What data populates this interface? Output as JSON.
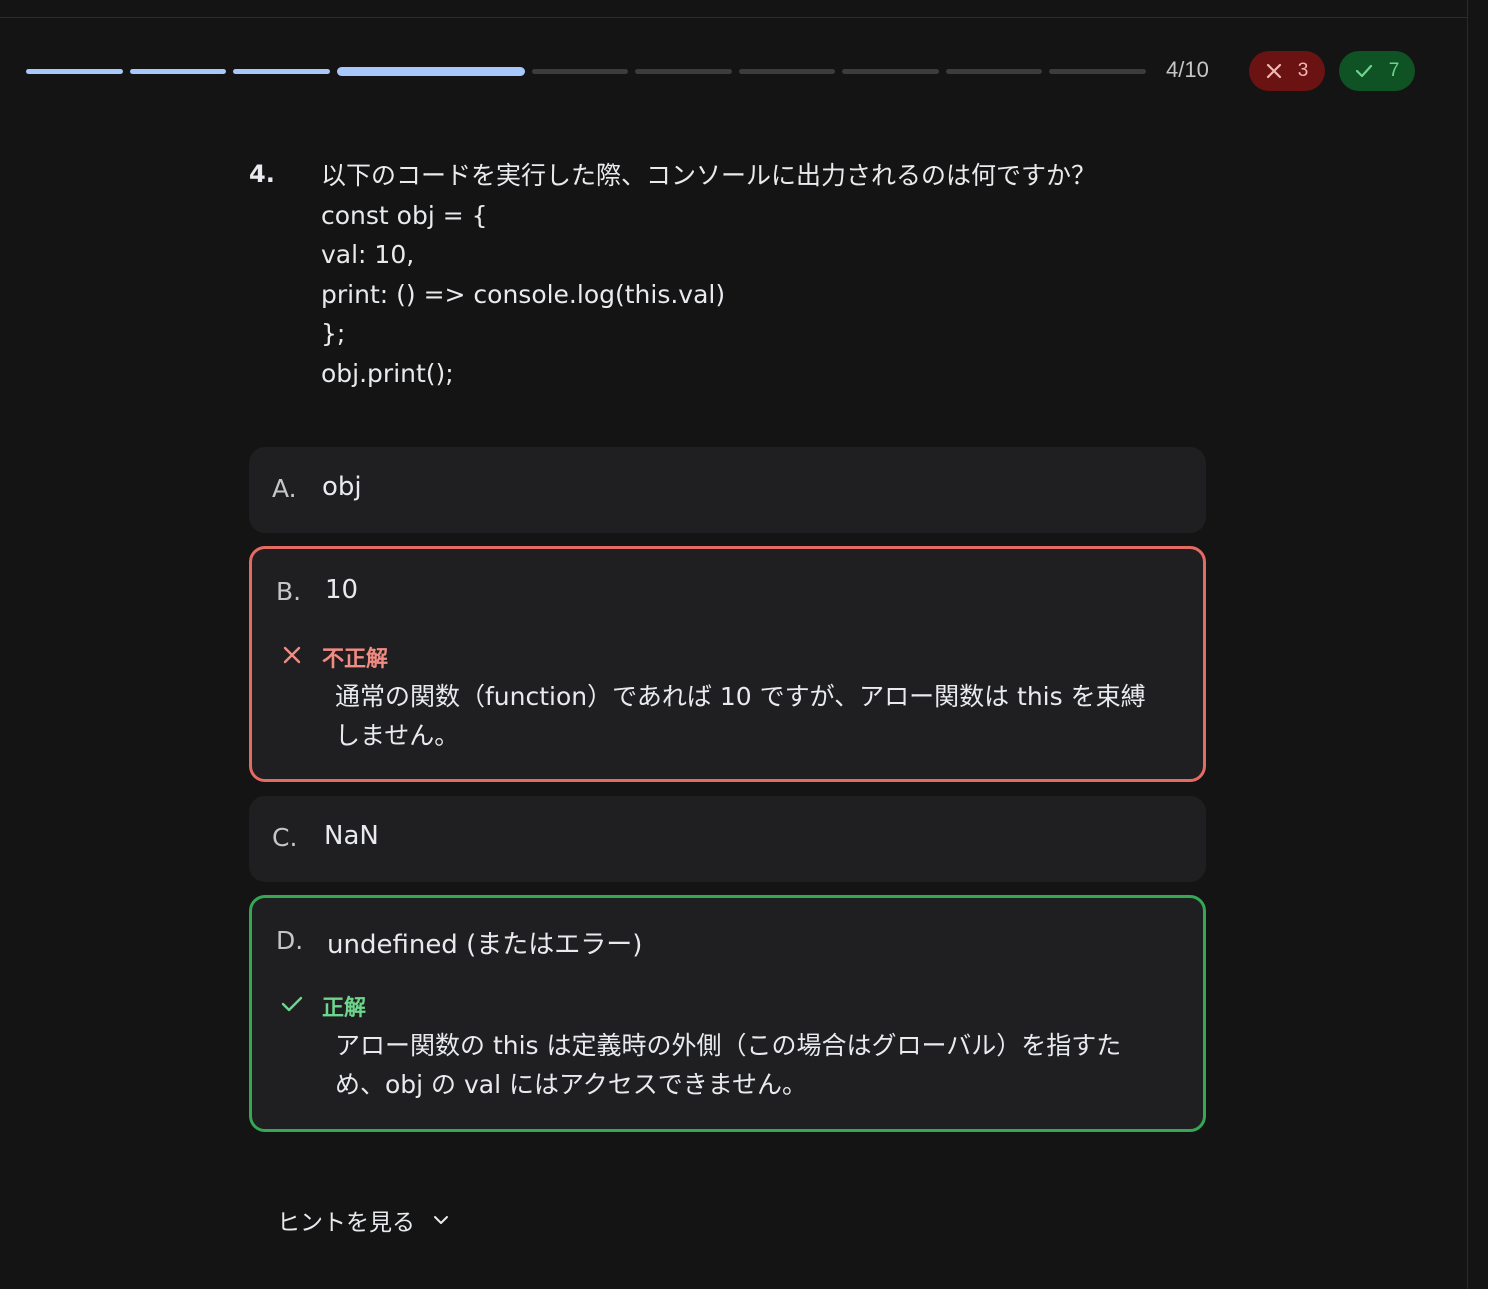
{
  "progress": {
    "total": 10,
    "current": 4,
    "counter_label": "4/10"
  },
  "score": {
    "wrong_count": "3",
    "right_count": "7",
    "wrong_color": "#6b1212",
    "right_color": "#0f5223"
  },
  "question": {
    "number": "4.",
    "lines": [
      "以下のコードを実行した際、コンソールに出力されるのは何ですか？",
      "const obj = {",
      "val: 10,",
      "print: () => console.log(this.val)",
      "};",
      "obj.print();"
    ]
  },
  "options": [
    {
      "letter": "A.",
      "text": "obj"
    },
    {
      "letter": "B.",
      "text": "10",
      "feedback_label": "不正解",
      "feedback_lines": [
        "通常の関数（function）であれば 10 ですが、アロー関数は this を束縛",
        "しません。"
      ]
    },
    {
      "letter": "C.",
      "text": "NaN"
    },
    {
      "letter": "D.",
      "text": "undefined (またはエラー)",
      "feedback_label": "正解",
      "feedback_lines": [
        "アロー関数の this は定義時の外側（この場合はグローバル）を指すた",
        "め、obj の val にはアクセスできません。"
      ]
    }
  ],
  "hint": {
    "label": "ヒントを見る"
  },
  "icons": {
    "wrong": "close-icon",
    "right": "check-icon",
    "hint_toggle": "chevron-down-icon"
  }
}
